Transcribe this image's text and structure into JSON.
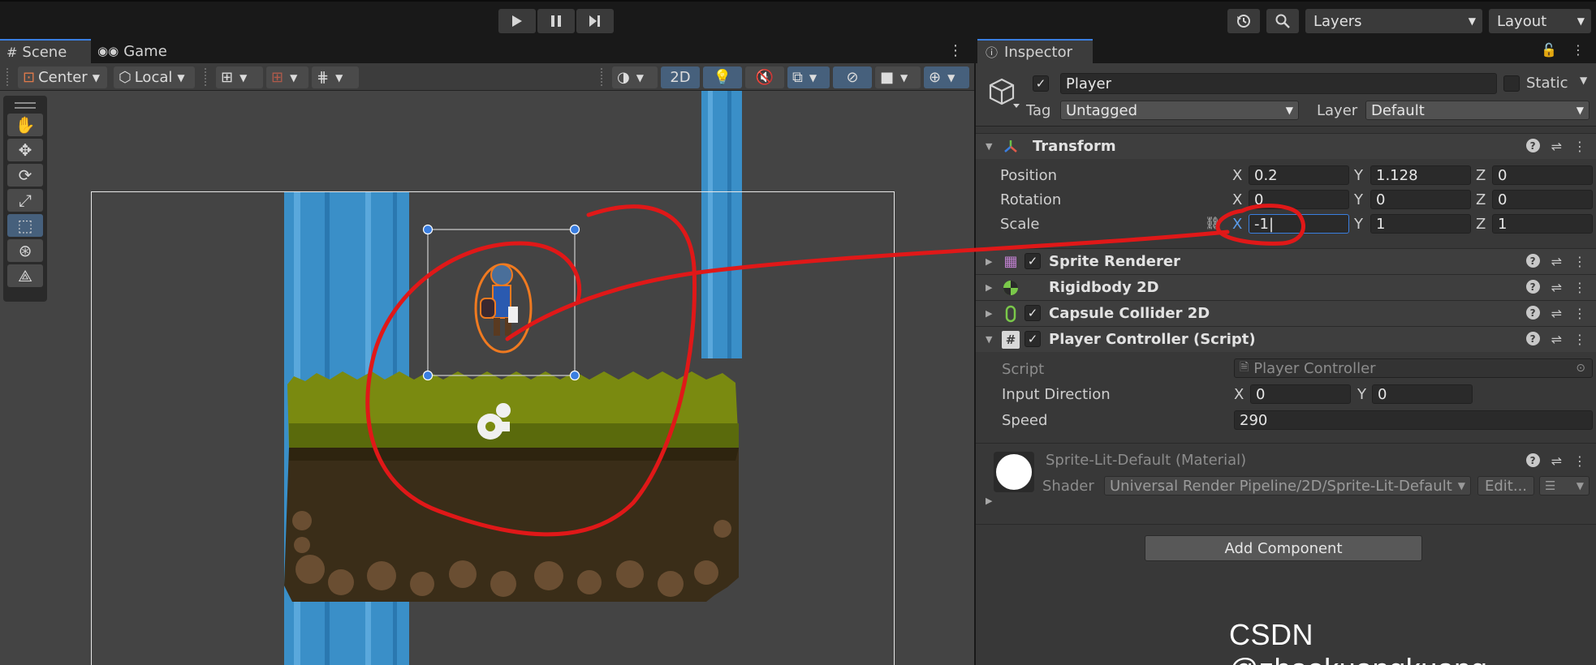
{
  "toolbar": {
    "play_icon": "play-icon",
    "pause_icon": "pause-icon",
    "step_icon": "step-icon",
    "layers_label": "Layers",
    "layout_label": "Layout"
  },
  "scene": {
    "tab_scene": "Scene",
    "tab_game": "Game",
    "pivot_label": "Center",
    "space_label": "Local",
    "mode_2d": "2D"
  },
  "inspector": {
    "tab_label": "Inspector",
    "object_name": "Player",
    "static_label": "Static",
    "tag_label": "Tag",
    "tag_value": "Untagged",
    "layer_label": "Layer",
    "layer_value": "Default",
    "transform": {
      "title": "Transform",
      "position_label": "Position",
      "rotation_label": "Rotation",
      "scale_label": "Scale",
      "position": {
        "x": "0.2",
        "y": "1.128",
        "z": "0"
      },
      "rotation": {
        "x": "0",
        "y": "0",
        "z": "0"
      },
      "scale": {
        "x": "-1",
        "y": "1",
        "z": "1"
      }
    },
    "components": {
      "sprite_renderer": "Sprite Renderer",
      "rigidbody": "Rigidbody 2D",
      "capsule_collider": "Capsule Collider 2D",
      "player_controller": "Player Controller (Script)"
    },
    "script": {
      "script_label": "Script",
      "script_value": "Player Controller",
      "input_direction_label": "Input Direction",
      "input_x": "0",
      "input_y": "0",
      "speed_label": "Speed",
      "speed_value": "290"
    },
    "material": {
      "name": "Sprite-Lit-Default (Material)",
      "shader_label": "Shader",
      "shader_value": "Universal Render Pipeline/2D/Sprite-Lit-Default",
      "edit_label": "Edit..."
    },
    "add_component_label": "Add Component"
  },
  "axis": {
    "x": "X",
    "y": "Y",
    "z": "Z"
  },
  "watermark": "CSDN @zhaokuangkuang_",
  "colors": {
    "accent_blue": "#3a7ee0",
    "annotation_red": "#e01818",
    "waterfall": "#3a8fc8",
    "grass": "#7a8a10",
    "dirt": "#3a2d18"
  }
}
